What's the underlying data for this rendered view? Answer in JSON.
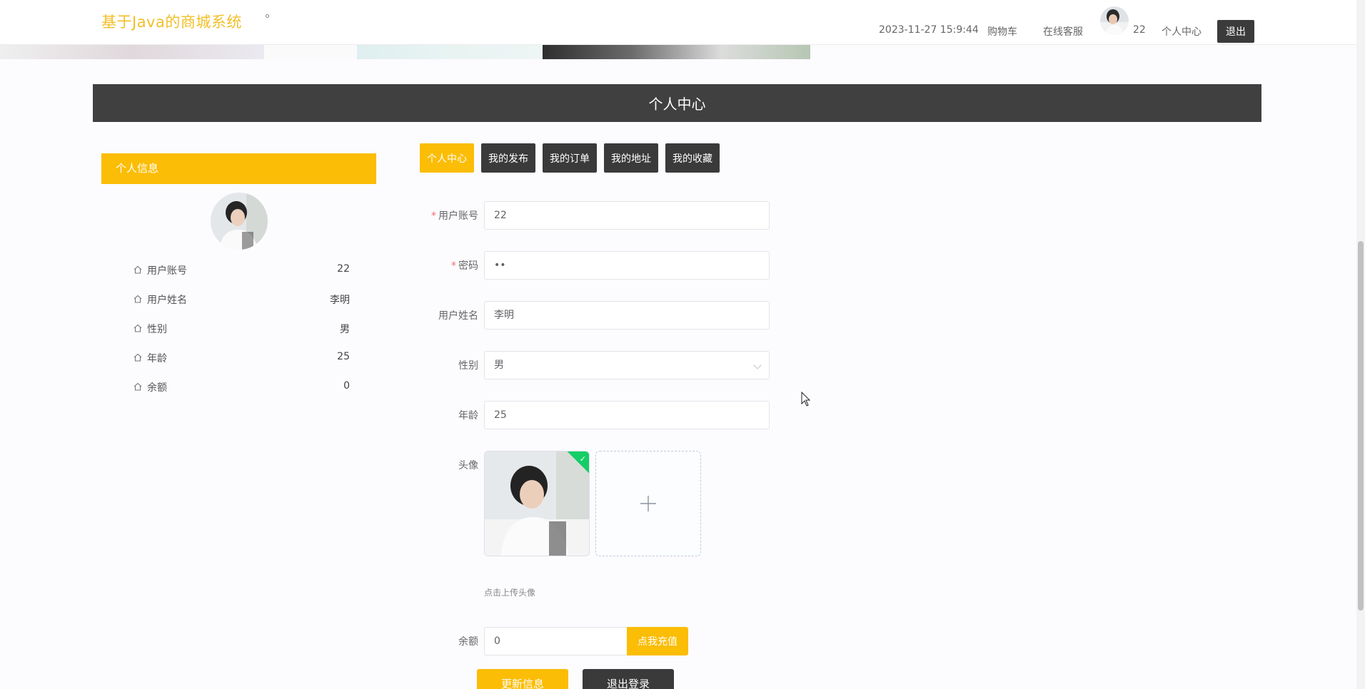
{
  "header": {
    "site_title": "基于Java的商城系统",
    "datetime": "2023-11-27 15:9:44",
    "cart_label": "购物车",
    "service_label": "在线客服",
    "username": "22",
    "center_label": "个人中心",
    "logout_label": "退出"
  },
  "section": {
    "title": "个人中心"
  },
  "info_panel": {
    "title": "个人信息",
    "rows": [
      {
        "label": "用户账号",
        "value": "22"
      },
      {
        "label": "用户姓名",
        "value": "李明"
      },
      {
        "label": "性别",
        "value": "男"
      },
      {
        "label": "年龄",
        "value": "25"
      },
      {
        "label": "余额",
        "value": "0"
      }
    ]
  },
  "tabs": [
    {
      "label": "个人中心",
      "active": true
    },
    {
      "label": "我的发布",
      "active": false
    },
    {
      "label": "我的订单",
      "active": false
    },
    {
      "label": "我的地址",
      "active": false
    },
    {
      "label": "我的收藏",
      "active": false
    }
  ],
  "form": {
    "account_label": "用户账号",
    "account_value": "22",
    "password_label": "密码",
    "password_value": "••",
    "name_label": "用户姓名",
    "name_value": "李明",
    "gender_label": "性别",
    "gender_value": "男",
    "age_label": "年龄",
    "age_value": "25",
    "avatar_label": "头像",
    "avatar_tip": "点击上传头像",
    "balance_label": "余额",
    "balance_value": "0",
    "recharge_label": "点我充值",
    "update_label": "更新信息",
    "logout_label": "退出登录"
  },
  "colors": {
    "accent": "#fbbd05",
    "dark": "#3a3a3a",
    "title": "#f2bf28",
    "success": "#13ce66"
  }
}
